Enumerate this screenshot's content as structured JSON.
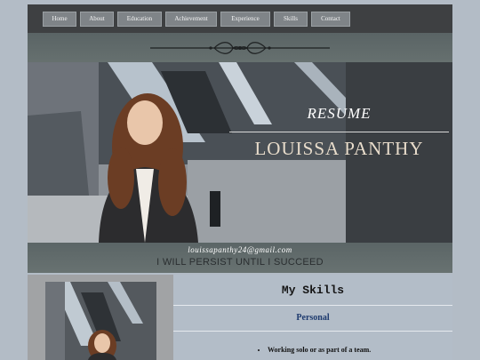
{
  "nav": {
    "items": [
      {
        "label": "Home"
      },
      {
        "label": "About"
      },
      {
        "label": "Education"
      },
      {
        "label": "Achievement"
      },
      {
        "label": "Experience"
      },
      {
        "label": "Skills"
      },
      {
        "label": "Contact"
      }
    ]
  },
  "hero": {
    "title": "RESUME",
    "name": "LOUISSA PANTHY",
    "email": "louissapanthy24@gmail.com",
    "motto": "I WILL PERSIST UNTIL I SUCCEED"
  },
  "skills": {
    "heading": "My Skills",
    "subheading": "Personal",
    "items": [
      "Working solo or as part of a team."
    ]
  },
  "colors": {
    "page_bg": "#b3bcc6",
    "nav_bg": "#3e4042",
    "nav_button": "#7f8488",
    "band": "#5f6969",
    "name_text": "#e8dccb",
    "personal_text": "#1d3a6e"
  },
  "icons": [
    "ornament-divider-icon",
    "profile-photo",
    "profile-photo-small"
  ]
}
